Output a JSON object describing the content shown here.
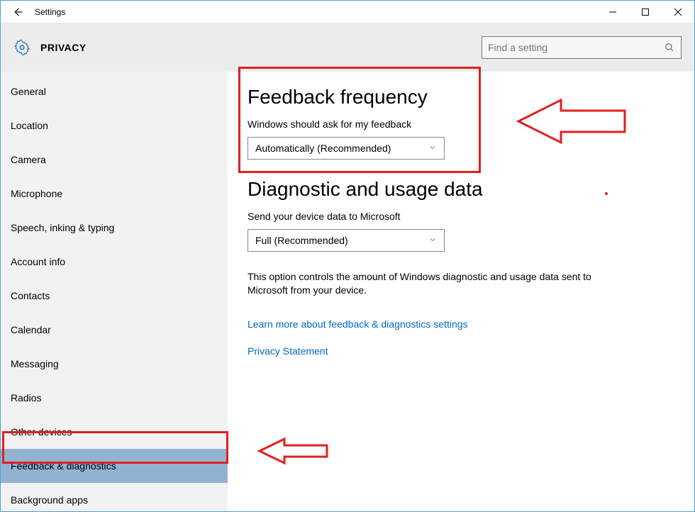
{
  "window": {
    "title": "Settings"
  },
  "header": {
    "page_title": "PRIVACY",
    "search_placeholder": "Find a setting"
  },
  "sidebar": {
    "items": [
      {
        "label": "General"
      },
      {
        "label": "Location"
      },
      {
        "label": "Camera"
      },
      {
        "label": "Microphone"
      },
      {
        "label": "Speech, inking & typing"
      },
      {
        "label": "Account info"
      },
      {
        "label": "Contacts"
      },
      {
        "label": "Calendar"
      },
      {
        "label": "Messaging"
      },
      {
        "label": "Radios"
      },
      {
        "label": "Other devices"
      },
      {
        "label": "Feedback & diagnostics",
        "selected": true
      },
      {
        "label": "Background apps"
      }
    ]
  },
  "content": {
    "section1_title": "Feedback frequency",
    "section1_label": "Windows should ask for my feedback",
    "section1_value": "Automatically (Recommended)",
    "section2_title": "Diagnostic and usage data",
    "section2_label": "Send your device data to Microsoft",
    "section2_value": "Full (Recommended)",
    "description": "This option controls the amount of Windows diagnostic and usage data sent to Microsoft from your device.",
    "link1": "Learn more about feedback & diagnostics settings",
    "link2": "Privacy Statement"
  },
  "annotations": {
    "highlight_color": "#e02020"
  }
}
